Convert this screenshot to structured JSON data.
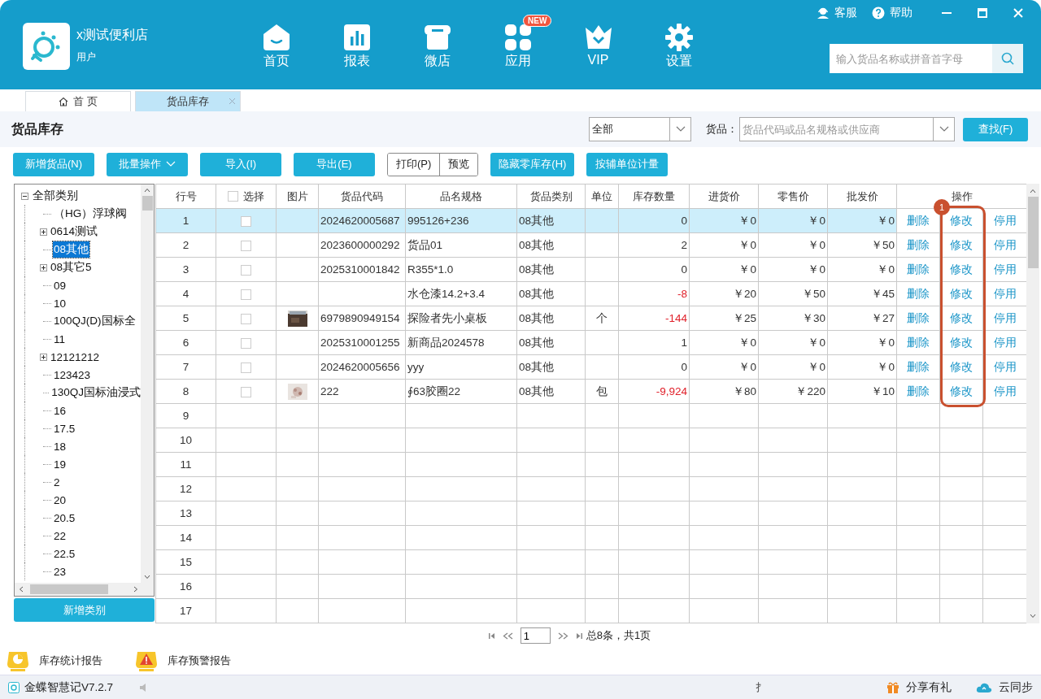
{
  "header": {
    "store_name": "x测试便利店",
    "user_role": "用户",
    "nav": [
      {
        "label": "首页"
      },
      {
        "label": "报表"
      },
      {
        "label": "微店"
      },
      {
        "label": "应用",
        "badge": "NEW"
      },
      {
        "label": "VIP"
      },
      {
        "label": "设置"
      }
    ],
    "links": [
      {
        "label": "客服"
      },
      {
        "label": "帮助"
      }
    ],
    "search": {
      "placeholder": "输入货品名称或拼音首字母"
    }
  },
  "tabs": [
    {
      "label": "首 页",
      "selected": false,
      "closable": false
    },
    {
      "label": "货品库存",
      "selected": true,
      "closable": true
    }
  ],
  "page_title": "货品库存",
  "filter": {
    "category": "全部",
    "goods_label": "货品：",
    "goods_placeholder": "货品代码或品名规格或供应商",
    "find_button": "查找(F)"
  },
  "toolbar": [
    {
      "label": "新增货品(N)",
      "kind": "primary"
    },
    {
      "label": "批量操作",
      "kind": "dropdown"
    },
    {
      "label": "导入(I)",
      "kind": "primary"
    },
    {
      "label": "导出(E)",
      "kind": "primary"
    },
    {
      "label": "打印(P)",
      "kind": "outline"
    },
    {
      "label": "预览",
      "kind": "outline"
    },
    {
      "label": "隐藏零库存(H)",
      "kind": "primary"
    },
    {
      "label": "按辅单位计量",
      "kind": "primary"
    }
  ],
  "tree": {
    "label": "全部类别",
    "expanded": true,
    "selected": false,
    "children": [
      {
        "label": "（HG）浮球阀",
        "has_children": false,
        "selected": false
      },
      {
        "label": "0614测试",
        "has_children": true,
        "selected": false
      },
      {
        "label": "08其他",
        "has_children": false,
        "selected": true
      },
      {
        "label": "08其它5",
        "has_children": true,
        "selected": false
      },
      {
        "label": "09",
        "has_children": false,
        "selected": false
      },
      {
        "label": "10",
        "has_children": false,
        "selected": false
      },
      {
        "label": "100QJ(D)国标全",
        "has_children": false,
        "selected": false
      },
      {
        "label": "11",
        "has_children": false,
        "selected": false
      },
      {
        "label": "12121212",
        "has_children": true,
        "selected": false
      },
      {
        "label": "123423",
        "has_children": false,
        "selected": false
      },
      {
        "label": "130QJ国标油浸式",
        "has_children": false,
        "selected": false
      },
      {
        "label": "16",
        "has_children": false,
        "selected": false
      },
      {
        "label": "17.5",
        "has_children": false,
        "selected": false
      },
      {
        "label": "18",
        "has_children": false,
        "selected": false
      },
      {
        "label": "19",
        "has_children": false,
        "selected": false
      },
      {
        "label": "2",
        "has_children": false,
        "selected": false
      },
      {
        "label": "20",
        "has_children": false,
        "selected": false
      },
      {
        "label": "20.5",
        "has_children": false,
        "selected": false
      },
      {
        "label": "22",
        "has_children": false,
        "selected": false
      },
      {
        "label": "22.5",
        "has_children": false,
        "selected": false
      },
      {
        "label": "23",
        "has_children": false,
        "selected": false
      }
    ]
  },
  "add_category_button": "新增类别",
  "table": {
    "columns": [
      "行号",
      "选择",
      "图片",
      "货品代码",
      "品名规格",
      "货品类别",
      "单位",
      "库存数量",
      "进货价",
      "零售价",
      "批发价",
      "操作"
    ],
    "select_all_checked": false,
    "rows": [
      {
        "no": "1",
        "selected": true,
        "checked": false,
        "code": "2024620005687",
        "name": "995126+236",
        "category": "08其他",
        "stock": "0",
        "negative": false,
        "cost": "￥0",
        "retail": "￥0",
        "wholesale": "￥0",
        "actions": [
          "删除",
          "修改",
          "停用"
        ]
      },
      {
        "no": "2",
        "selected": false,
        "checked": false,
        "code": "2023600000292",
        "name": "货品01",
        "category": "08其他",
        "stock": "2",
        "negative": false,
        "cost": "￥0",
        "retail": "￥0",
        "wholesale": "￥50",
        "actions": [
          "删除",
          "修改",
          "停用"
        ]
      },
      {
        "no": "3",
        "selected": false,
        "checked": false,
        "code": "2025310001842",
        "name": "R355*1.0",
        "category": "08其他",
        "stock": "0",
        "negative": false,
        "cost": "￥0",
        "retail": "￥0",
        "wholesale": "￥0",
        "actions": [
          "删除",
          "修改",
          "停用"
        ]
      },
      {
        "no": "4",
        "selected": false,
        "checked": false,
        "name": "水仓漆14.2+3.4",
        "category": "08其他",
        "stock": "-8",
        "negative": true,
        "cost": "￥20",
        "retail": "￥50",
        "wholesale": "￥45",
        "actions": [
          "删除",
          "修改",
          "停用"
        ]
      },
      {
        "no": "5",
        "selected": false,
        "checked": false,
        "code": "6979890949154",
        "name": "探险者先小桌板",
        "category": "08其他",
        "unit": "个",
        "stock": "-144",
        "negative": true,
        "cost": "￥25",
        "retail": "￥30",
        "wholesale": "￥27",
        "actions": [
          "删除",
          "修改",
          "停用"
        ]
      },
      {
        "no": "6",
        "selected": false,
        "checked": false,
        "code": "2025310001255",
        "name": "新商品2024578",
        "category": "08其他",
        "stock": "1",
        "negative": false,
        "cost": "￥0",
        "retail": "￥0",
        "wholesale": "￥0",
        "actions": [
          "删除",
          "修改",
          "停用"
        ]
      },
      {
        "no": "7",
        "selected": false,
        "checked": false,
        "code": "2024620005656",
        "name": "yyy",
        "category": "08其他",
        "stock": "0",
        "negative": false,
        "cost": "￥0",
        "retail": "￥0",
        "wholesale": "￥0",
        "actions": [
          "删除",
          "修改",
          "停用"
        ]
      },
      {
        "no": "8",
        "selected": false,
        "checked": false,
        "code": "222",
        "name": "∮63胶圈22",
        "category": "08其他",
        "unit": "包",
        "stock": "-9,924",
        "negative": true,
        "cost": "￥80",
        "retail": "￥220",
        "wholesale": "￥10",
        "actions": [
          "删除",
          "修改",
          "停用"
        ]
      }
    ],
    "empty_rows": [
      "9",
      "10",
      "11",
      "12",
      "13",
      "14",
      "15",
      "16",
      "17"
    ],
    "annotation": {
      "badge": "1"
    }
  },
  "pagination": {
    "page": "1",
    "summary": "总8条，共1页"
  },
  "reports": [
    {
      "label": "库存统计报告"
    },
    {
      "label": "库存预警报告"
    }
  ],
  "status_bar": {
    "version": "金蝶智慧记V7.2.7",
    "mark": "扌",
    "share": "分享有礼",
    "sync": "云同步"
  }
}
